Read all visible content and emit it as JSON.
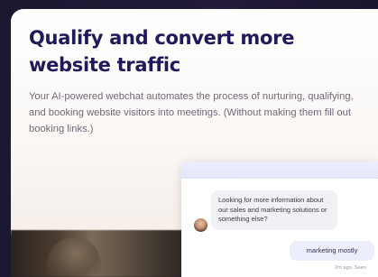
{
  "hero": {
    "headline": "Qualify and convert more website traffic",
    "description": "Your AI-powered webchat automates the process of nurturing, qualifying, and booking website visitors into meetings. (Without making them fill out booking links.)"
  },
  "chat": {
    "incoming_message": "Looking for more information about our sales and marketing solutions or something else?",
    "outgoing_message": "marketing mostly",
    "timestamp": "2m ago. Seen"
  },
  "colors": {
    "headline": "#1f1a5c",
    "body_text": "#6f6878",
    "background": "#1c1730",
    "chat_header": "#e4e6fb"
  },
  "icons": {
    "avatar": "agent-avatar"
  }
}
